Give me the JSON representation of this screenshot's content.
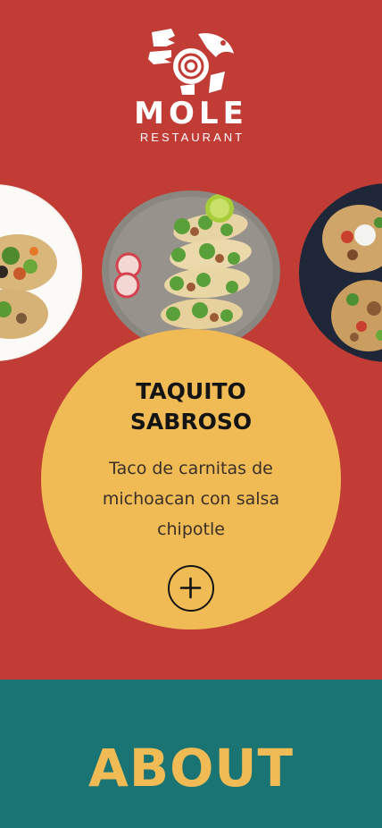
{
  "brand": {
    "name": "MOLE",
    "subtitle": "RESTAURANT",
    "logo_icon": "aztec-bird-logo"
  },
  "colors": {
    "hero_bg": "#c03c35",
    "card_bg": "#f0bb55",
    "about_bg": "#197473",
    "about_text": "#f0bb55"
  },
  "carousel": {
    "items": [
      {
        "image": "tacos-plate-left"
      },
      {
        "image": "tacos-plate-center"
      },
      {
        "image": "tacos-plate-right"
      }
    ],
    "active": {
      "title": "TAQUITO SABROSO",
      "title_line1": "TAQUITO",
      "title_line2": "SABROSO",
      "description_line1": "Taco de carnitas de",
      "description_line2": "michoacan con salsa",
      "description_line3": "chipotle",
      "action_icon": "plus-circle-icon"
    }
  },
  "about": {
    "title": "ABOUT"
  }
}
